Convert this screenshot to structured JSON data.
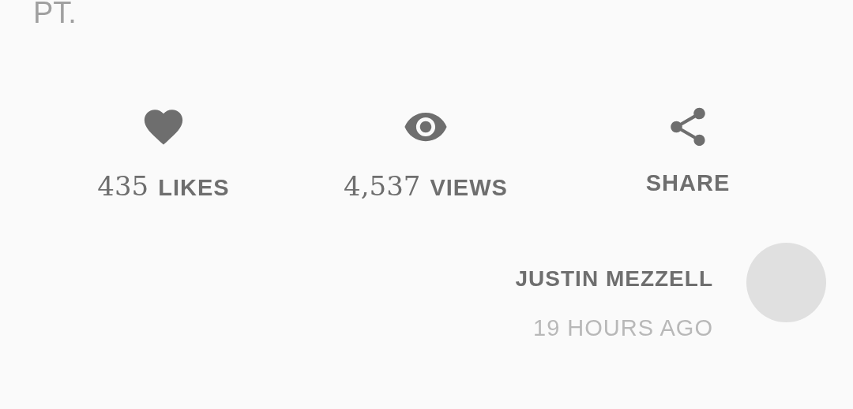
{
  "intro_text": "PT.",
  "stats": [
    {
      "kind": "likes",
      "count": "435",
      "label": "LIKES"
    },
    {
      "kind": "views",
      "count": "4,537",
      "label": "VIEWS"
    },
    {
      "kind": "share",
      "label": "SHARE"
    }
  ],
  "author": {
    "name": "JUSTIN MEZZELL",
    "time": "19 HOURS AGO"
  }
}
